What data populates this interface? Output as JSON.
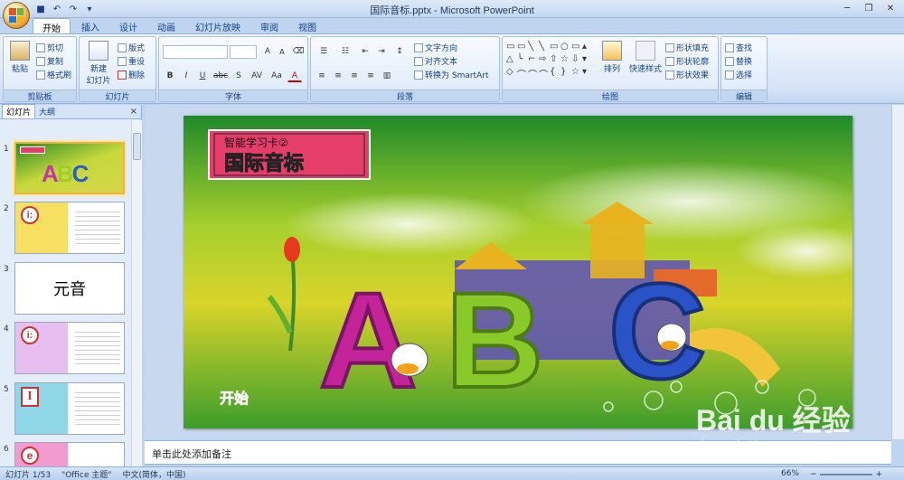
{
  "window": {
    "title": "国际音标.pptx - Microsoft PowerPoint"
  },
  "tabs": [
    "开始",
    "插入",
    "设计",
    "动画",
    "幻灯片放映",
    "审阅",
    "视图"
  ],
  "ribbon": {
    "clipboard": {
      "label": "剪贴板",
      "paste": "粘贴",
      "cut": "剪切",
      "copy": "复制",
      "painter": "格式刷"
    },
    "slides": {
      "label": "幻灯片",
      "new_slide": "新建",
      "new_slide2": "幻灯片",
      "layout": "版式",
      "reset": "重设",
      "delete": "删除"
    },
    "font": {
      "label": "字体",
      "bold": "B",
      "italic": "I",
      "underline": "U",
      "strike": "abc",
      "shadow": "S",
      "spacing": "AV",
      "case": "Aa",
      "color": "A",
      "grow": "A",
      "shrink": "A"
    },
    "paragraph": {
      "label": "段落",
      "text_direction": "文字方向",
      "align_text": "对齐文本",
      "smartart": "转换为 SmartArt"
    },
    "drawing": {
      "label": "绘图",
      "arrange": "排列",
      "quick_styles": "快速样式",
      "fill": "形状填充",
      "outline": "形状轮廓",
      "effects": "形状效果"
    },
    "editing": {
      "label": "编辑",
      "find": "查找",
      "replace": "替换",
      "select": "选择"
    }
  },
  "panel": {
    "tab_slides": "幻灯片",
    "tab_outline": "大纲",
    "close": "×"
  },
  "thumbnails": [
    {
      "num": "1",
      "text": "",
      "kind": "title"
    },
    {
      "num": "2",
      "text": "i:",
      "kind": "card"
    },
    {
      "num": "3",
      "text": "元音",
      "kind": "text"
    },
    {
      "num": "4",
      "text": "i:",
      "kind": "card"
    },
    {
      "num": "5",
      "text": "I",
      "kind": "card"
    },
    {
      "num": "6",
      "text": "e",
      "kind": "card"
    }
  ],
  "slide": {
    "label_top": "智能学习卡②",
    "label_main": "国际音标",
    "letters": [
      "A",
      "B",
      "C"
    ],
    "start": "开始"
  },
  "notes": {
    "placeholder": "单击此处添加备注"
  },
  "status": {
    "slide": "幻灯片 1/53",
    "theme": "\"Office 主题\"",
    "lang": "中文(简体，中国)",
    "zoom": "66%"
  },
  "watermark": {
    "brand": "Bai du 经验",
    "url": "jingyan.baidu.com"
  },
  "colors": {
    "accent_orange": "#f3b23a",
    "ribbon_blue": "#15428b"
  }
}
